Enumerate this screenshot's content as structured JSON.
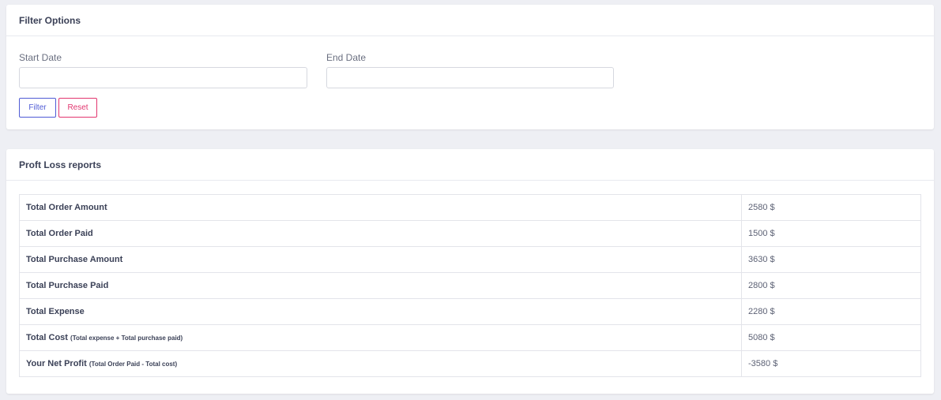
{
  "filter": {
    "title": "Filter Options",
    "start_label": "Start Date",
    "start_value": "",
    "end_label": "End Date",
    "end_value": "",
    "filter_button": "Filter",
    "reset_button": "Reset"
  },
  "report": {
    "title": "Proft Loss reports",
    "rows": [
      {
        "label": "Total Order Amount",
        "note": "",
        "value": "2580 $"
      },
      {
        "label": "Total Order Paid",
        "note": "",
        "value": "1500 $"
      },
      {
        "label": "Total Purchase Amount",
        "note": "",
        "value": "3630 $"
      },
      {
        "label": "Total Purchase Paid",
        "note": "",
        "value": "2800 $"
      },
      {
        "label": "Total Expense",
        "note": "",
        "value": "2280 $"
      },
      {
        "label": "Total Cost",
        "note": "(Total expense + Total purchase paid)",
        "value": "5080 $"
      },
      {
        "label": "Your Net Profit",
        "note": "(Total Order Paid - Total cost)",
        "value": "-3580 $"
      }
    ]
  }
}
